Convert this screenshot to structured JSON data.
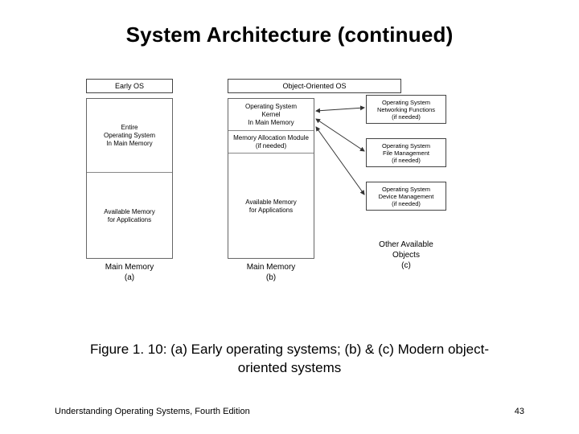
{
  "title": "System Architecture (continued)",
  "caption": "Figure 1. 10: (a) Early operating systems; (b) & (c) Modern object-oriented systems",
  "footer": {
    "book": "Understanding Operating Systems, Fourth Edition",
    "page": "43"
  },
  "col_a": {
    "header": "Early OS",
    "s1": "Entire\nOperating System\nIn Main Memory",
    "s2": "Available Memory\nfor Applications",
    "label1": "Main Memory",
    "label2": "(a)"
  },
  "col_b": {
    "header": "Object-Oriented OS",
    "s1": "Operating System\nKernel\nIn Main Memory",
    "s2": "Memory Allocation Module\n(if needed)",
    "s3": "Available Memory\nfor Applications",
    "label1": "Main Memory",
    "label2": "(b)"
  },
  "col_c": {
    "o1": "Operating System\nNetworking Functions\n(if needed)",
    "o2": "Operating System\nFile Management\n(if needed)",
    "o3": "Operating System\nDevice Management\n(if needed)",
    "label1": "Other Available",
    "label2": "Objects",
    "label3": "(c)"
  }
}
